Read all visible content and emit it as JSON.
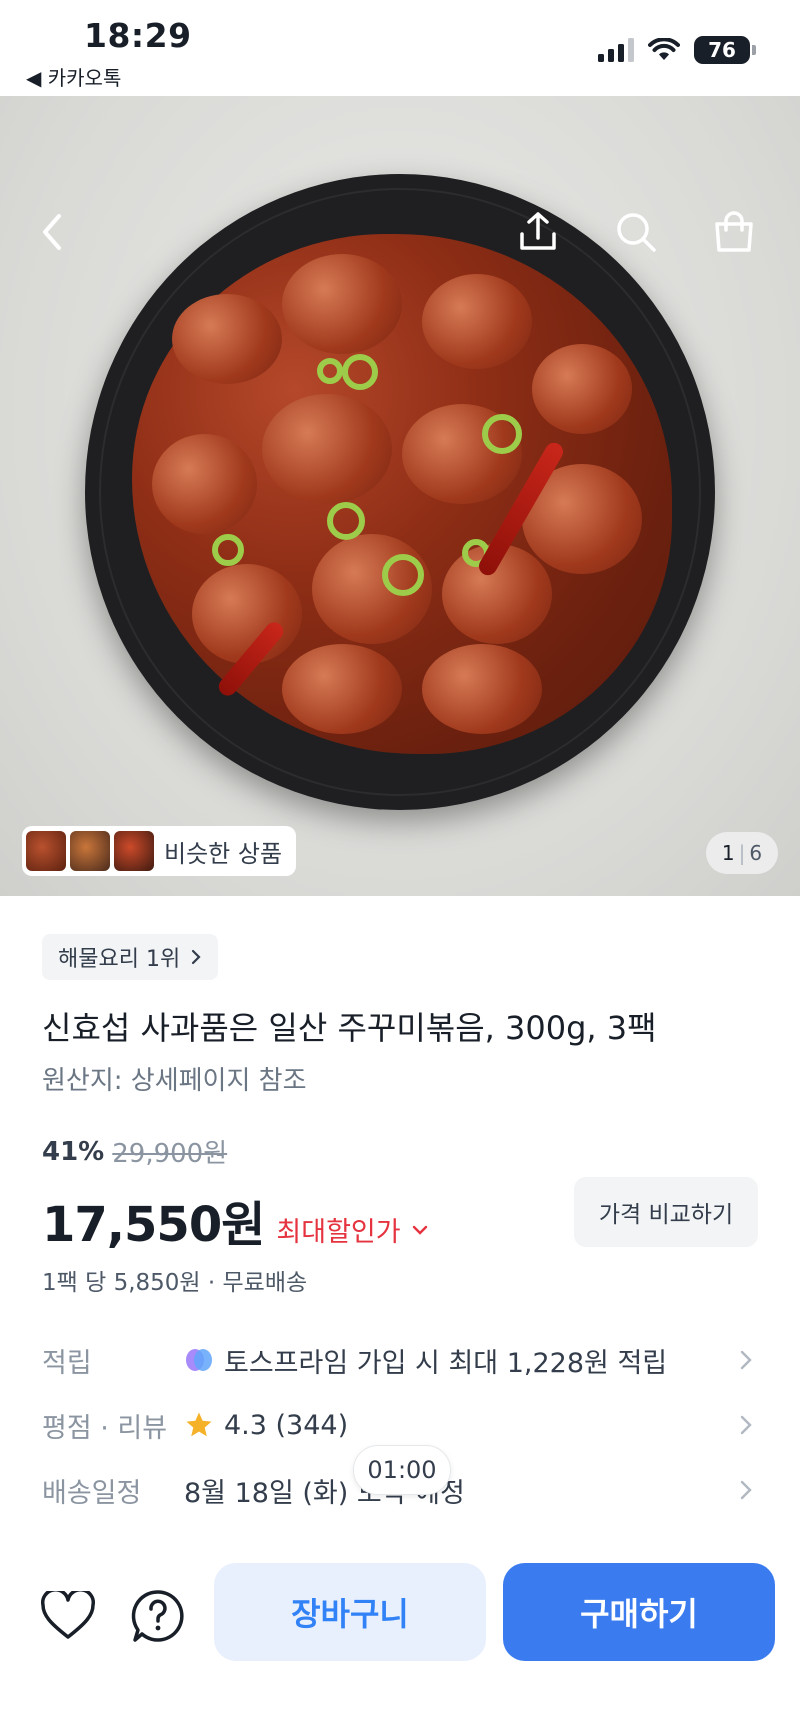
{
  "status_bar": {
    "time": "18:29",
    "back_app": "◀ 카카오톡",
    "battery": "76",
    "icons": [
      "cellular-signal-icon",
      "wifi-icon",
      "battery-icon"
    ]
  },
  "hero": {
    "nav_icons": [
      "back-arrow-icon",
      "share-icon",
      "search-icon",
      "shopping-bag-icon"
    ],
    "similar_label": "비슷한 상품",
    "page_current": "1",
    "page_separator": "|",
    "page_total": "6"
  },
  "product": {
    "badge": "해물요리 1위",
    "title": "신효섭 사과품은 일산 주꾸미볶음, 300g, 3팩",
    "origin": "원산지: 상세페이지 참조",
    "discount_rate": "41%",
    "original_price": "29,900원",
    "price": "17,550원",
    "max_discount_label": "최대할인가",
    "compare_button": "가격 비교하기",
    "per_pack": "1팩 당 5,850원 · 무료배송"
  },
  "info_rows": [
    {
      "label": "적립",
      "value": "토스프라임 가입 시 최대 1,228원 적립",
      "icon": "toss-prime-icon"
    },
    {
      "label": "평점 · 리뷰",
      "value": "4.3 (344)",
      "icon": "star-icon"
    },
    {
      "label": "배송일정",
      "value": "8월 18일 (화) 도착 예정"
    }
  ],
  "toast": "01:00",
  "bottom_bar": {
    "cart_button": "장바구니",
    "buy_button": "구매하기",
    "icons": [
      "heart-icon",
      "help-icon"
    ]
  },
  "colors": {
    "accent_blue": "#3182f6",
    "buy_button_bg": "#3a7cf0",
    "cart_button_bg": "#e8f0fd",
    "discount_red": "#e5333f",
    "star": "#f5b128"
  }
}
